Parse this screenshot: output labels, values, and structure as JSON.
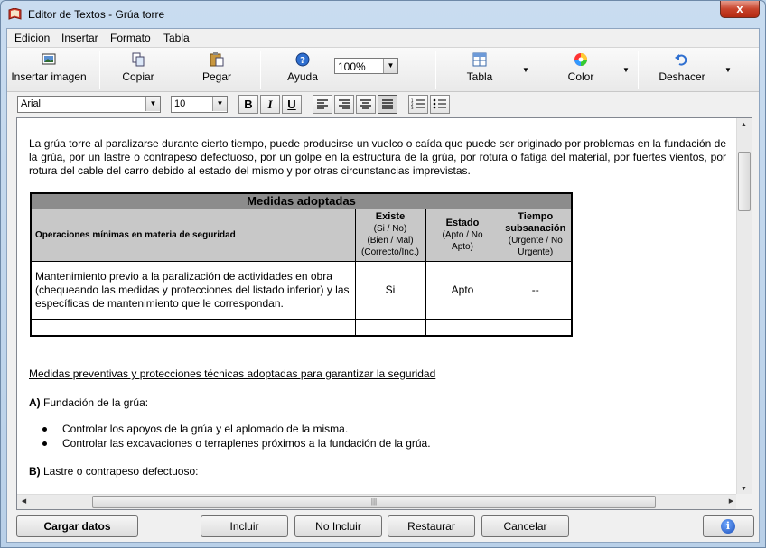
{
  "window": {
    "title": "Editor de Textos - Grúa torre",
    "close_label": "x"
  },
  "menu": [
    "Edicion",
    "Insertar",
    "Formato",
    "Tabla"
  ],
  "toolbar": {
    "insert_image": "Insertar imagen",
    "copy": "Copiar",
    "paste": "Pegar",
    "help": "Ayuda",
    "zoom": "100%",
    "table": "Tabla",
    "color": "Color",
    "undo": "Deshacer"
  },
  "format": {
    "font": "Arial",
    "size": "10",
    "bold": "B",
    "italic": "I",
    "underline": "U"
  },
  "document": {
    "intro": "La grúa torre al paralizarse durante cierto tiempo, puede producirse un vuelco o caída que puede ser originado por problemas en la fundación de la grúa, por un lastre o contrapeso defectuoso, por un golpe en la estructura de la grúa, por rotura o fatiga del material, por fuertes vientos, por rotura del cable del carro debido al estado del mismo y por otras circunstancias imprevistas.",
    "table": {
      "caption": "Medidas adoptadas",
      "col_ops": "Operaciones mínimas en materia de seguridad",
      "col_exists_title": "Existe",
      "col_exists_sub1": "(Si / No)",
      "col_exists_sub2": "(Bien / Mal)",
      "col_exists_sub3": "(Correcto/Inc.)",
      "col_state_title": "Estado",
      "col_state_sub1": "(Apto / No",
      "col_state_sub2": "Apto)",
      "col_time_title1": "Tiempo",
      "col_time_title2": "subsanación",
      "col_time_sub1": "(Urgente / No",
      "col_time_sub2": "Urgente)",
      "row1_desc": "Mantenimiento previo a la paralización de actividades en obra (chequeando las medidas y protecciones del listado inferior) y las específicas de mantenimiento que le correspondan.",
      "row1_exists": "Si",
      "row1_state": "Apto",
      "row1_time": "--"
    },
    "section_link": "Medidas preventivas y protecciones técnicas adoptadas para garantizar la seguridad",
    "section_a_letter": "A)",
    "section_a_text": " Fundación de la grúa:",
    "bullets": [
      "Controlar los apoyos de la grúa y el aplomado de la misma.",
      "Controlar las excavaciones o terraplenes próximos a la fundación de la grúa."
    ],
    "section_b_letter": "B)",
    "section_b_text": " Lastre o contrapeso defectuoso:"
  },
  "bottom": {
    "load": "Cargar datos",
    "include": "Incluir",
    "exclude": "No Incluir",
    "restore": "Restaurar",
    "cancel": "Cancelar"
  },
  "colors": {
    "caption_bg": "#8c8c8c",
    "header_bg": "#c8c8c8",
    "close_btn": "#c8432b"
  }
}
